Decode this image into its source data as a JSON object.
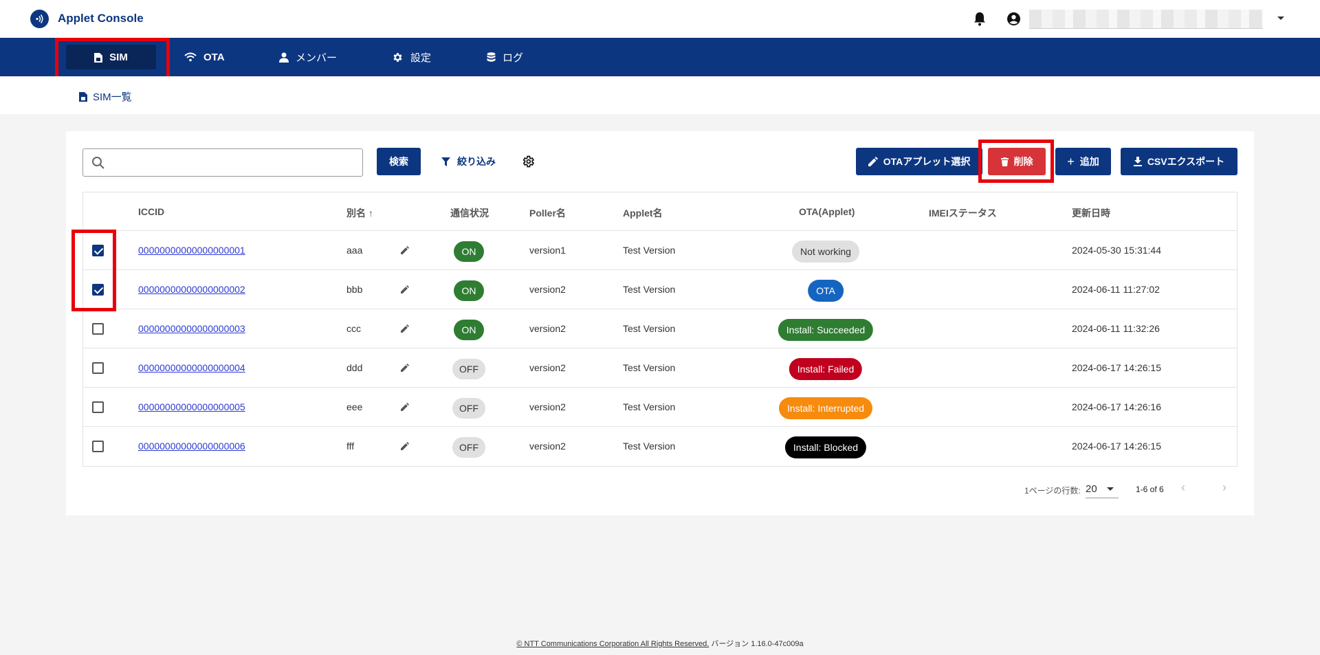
{
  "app": {
    "title": "Applet Console"
  },
  "nav": {
    "items": [
      {
        "label": "SIM",
        "icon": "sim-card-icon"
      },
      {
        "label": "OTA",
        "icon": "wifi-icon"
      },
      {
        "label": "メンバー",
        "icon": "person-icon"
      },
      {
        "label": "設定",
        "icon": "gear-icon"
      },
      {
        "label": "ログ",
        "icon": "database-icon"
      }
    ]
  },
  "breadcrumb": {
    "label": "SIM一覧"
  },
  "toolbar": {
    "search_placeholder": "",
    "search_label": "検索",
    "filter_label": "絞り込み",
    "ota_applet_label": "OTAアプレット選択",
    "delete_label": "削除",
    "add_label": "追加",
    "csv_label": "CSVエクスポート"
  },
  "table": {
    "columns": [
      "ICCID",
      "別名",
      "通信状況",
      "Poller名",
      "Applet名",
      "OTA(Applet)",
      "IMEIステータス",
      "更新日時"
    ],
    "rows": [
      {
        "checked": true,
        "iccid": "00000000000000000001",
        "alias": "aaa",
        "status": "ON",
        "poller": "version1",
        "applet": "Test Version",
        "ota": "Not working",
        "imei": "",
        "updated": "2024-05-30 15:31:44"
      },
      {
        "checked": true,
        "iccid": "00000000000000000002",
        "alias": "bbb",
        "status": "ON",
        "poller": "version2",
        "applet": "Test Version",
        "ota": "OTA",
        "imei": "",
        "updated": "2024-06-11 11:27:02"
      },
      {
        "checked": false,
        "iccid": "00000000000000000003",
        "alias": "ccc",
        "status": "ON",
        "poller": "version2",
        "applet": "Test Version",
        "ota": "Install: Succeeded",
        "imei": "",
        "updated": "2024-06-11 11:32:26"
      },
      {
        "checked": false,
        "iccid": "00000000000000000004",
        "alias": "ddd",
        "status": "OFF",
        "poller": "version2",
        "applet": "Test Version",
        "ota": "Install: Failed",
        "imei": "",
        "updated": "2024-06-17 14:26:15"
      },
      {
        "checked": false,
        "iccid": "00000000000000000005",
        "alias": "eee",
        "status": "OFF",
        "poller": "version2",
        "applet": "Test Version",
        "ota": "Install: Interrupted",
        "imei": "",
        "updated": "2024-06-17 14:26:16"
      },
      {
        "checked": false,
        "iccid": "00000000000000000006",
        "alias": "fff",
        "status": "OFF",
        "poller": "version2",
        "applet": "Test Version",
        "ota": "Install: Blocked",
        "imei": "",
        "updated": "2024-06-17 14:26:15"
      }
    ]
  },
  "ota_colors": {
    "Not working": {
      "bg": "#e0e0e0",
      "fg": "#333333"
    },
    "OTA": {
      "bg": "#1565c0",
      "fg": "#ffffff"
    },
    "Install: Succeeded": {
      "bg": "#2e7d32",
      "fg": "#ffffff"
    },
    "Install: Failed": {
      "bg": "#c0001e",
      "fg": "#ffffff"
    },
    "Install: Interrupted": {
      "bg": "#f68b0e",
      "fg": "#ffffff"
    },
    "Install: Blocked": {
      "bg": "#000000",
      "fg": "#ffffff"
    }
  },
  "pagination": {
    "rows_per_page_label": "1ページの行数:",
    "rows_per_page": "20",
    "range": "1-6 of 6"
  },
  "footer": {
    "copyright": "© NTT Communications Corporation All Rights Reserved.",
    "version": "バージョン 1.16.0-47c009a"
  },
  "colors": {
    "brand": "#0d3680",
    "delete": "#d63439",
    "highlight": "#e8000b"
  }
}
